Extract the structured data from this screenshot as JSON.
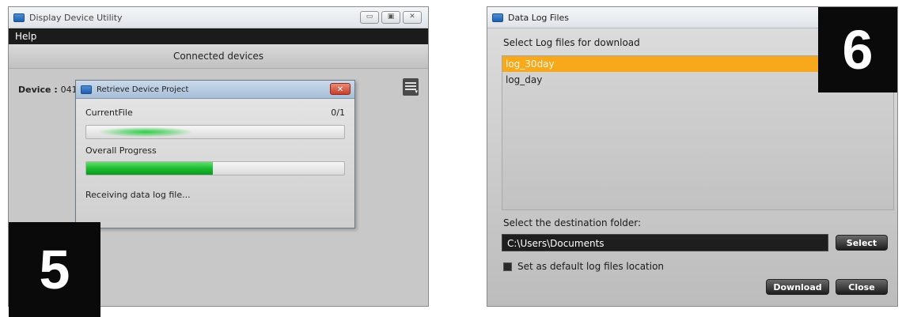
{
  "left": {
    "window_title": "Display Device Utility",
    "window_controls": [
      "▭",
      "▣",
      "✕"
    ],
    "menu": {
      "help": "Help"
    },
    "connected_devices": "Connected devices",
    "device_label": "Device :",
    "device_id": "041",
    "device_menu_icon": "hamburger-menu-icon",
    "dialog": {
      "title": "Retrieve Device Project",
      "close": "✕",
      "current_file_label": "CurrentFile",
      "current_file_count": "0/1",
      "overall_label": "Overall Progress",
      "overall_progress": 0.49,
      "status": "Receiving data log file..."
    },
    "step_badge": "5"
  },
  "right": {
    "window_title": "Data Log Files",
    "select_label": "Select Log files for download",
    "log_files": [
      {
        "name": "log_30day",
        "selected": true
      },
      {
        "name": "log_day",
        "selected": false
      }
    ],
    "dest_label": "Select the destination folder:",
    "dest_path": "C:\\Users\\Documents",
    "select_button": "Select",
    "default_checkbox_label": "Set as default log files location",
    "download_button": "Download",
    "close_button": "Close",
    "step_badge": "6"
  },
  "colors": {
    "selection": "#f7a81b",
    "progress": "#17b82c",
    "dark_field": "#1e1e1e"
  }
}
